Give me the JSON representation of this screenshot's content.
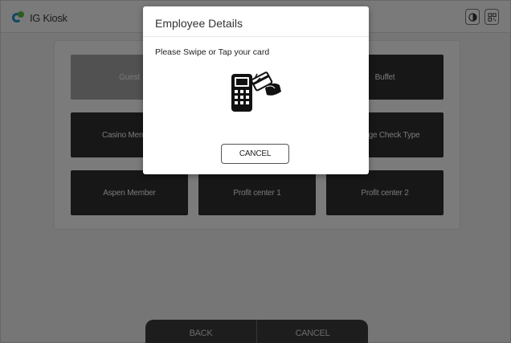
{
  "header": {
    "logo_text": "IG Kiosk",
    "icons": [
      "contrast-icon",
      "qr-code-icon"
    ]
  },
  "tiles": [
    {
      "label": "Guest",
      "style": "light"
    },
    {
      "label": "Buffet",
      "style": "dark"
    },
    {
      "label": "Casino Member",
      "style": "dark"
    },
    {
      "label": "Change Check Type",
      "style": "dark"
    },
    {
      "label": "Aspen Member",
      "style": "dark"
    },
    {
      "label": "Profit center 1",
      "style": "dark"
    },
    {
      "label": "Profit center 2",
      "style": "dark"
    }
  ],
  "footer": {
    "back_label": "BACK",
    "cancel_label": "CANCEL"
  },
  "modal": {
    "title": "Employee Details",
    "message": "Please Swipe or Tap your card",
    "icon": "card-terminal-icon",
    "cancel_label": "CANCEL"
  },
  "colors": {
    "tile_dark": "#2f2f2f",
    "tile_light": "#a2a2a2",
    "logo_blue": "#1e8fc9",
    "logo_green": "#5bb947",
    "overlay": "rgba(0,0,0,0.5)"
  }
}
